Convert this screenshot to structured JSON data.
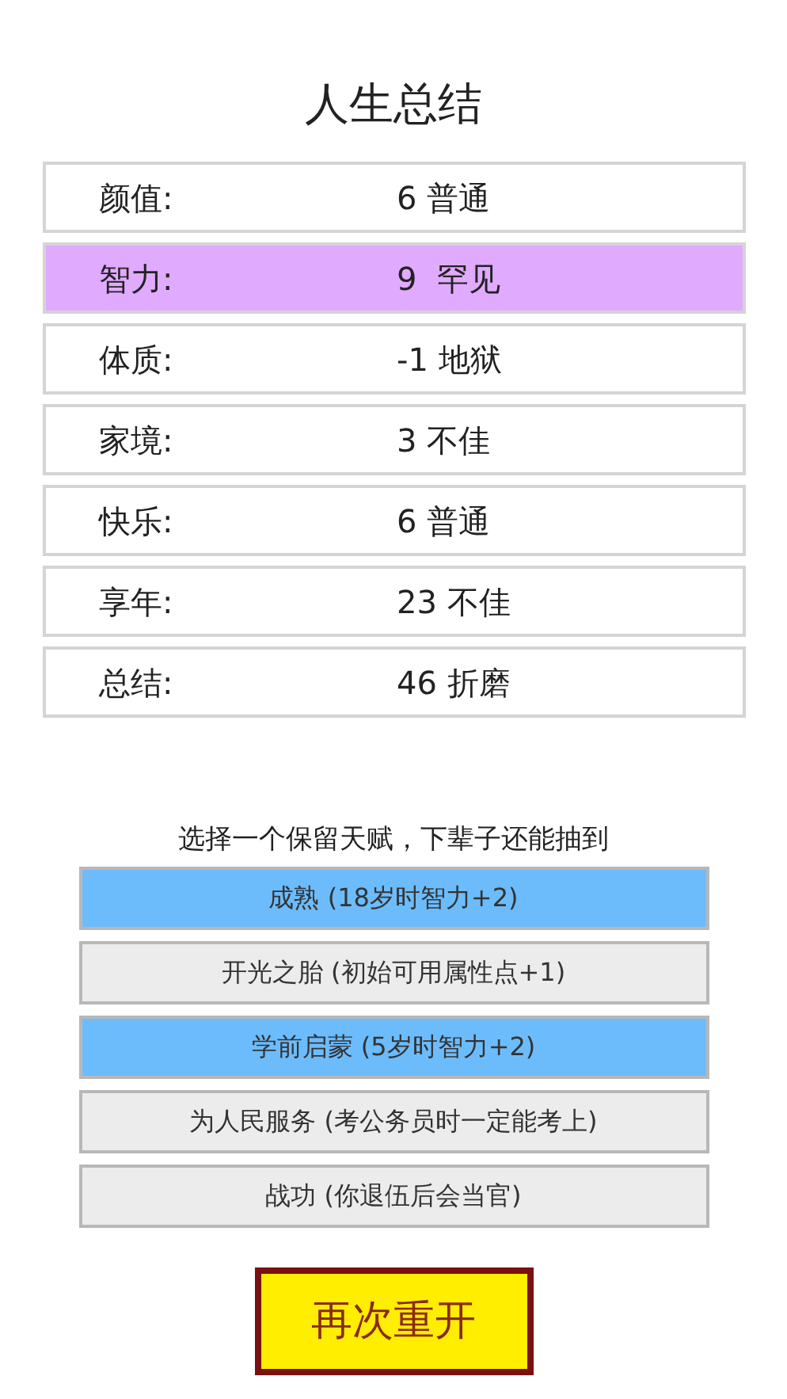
{
  "title": "人生总结",
  "stats": [
    {
      "label": "颜值:",
      "value": "6 普通",
      "color": "#ffffff"
    },
    {
      "label": "智力:",
      "value": "9  罕见",
      "color": "#e0aaff"
    },
    {
      "label": "体质:",
      "value": "-1 地狱",
      "color": "#ffffff"
    },
    {
      "label": "家境:",
      "value": "3 不佳",
      "color": "#ffffff"
    },
    {
      "label": "快乐:",
      "value": "6 普通",
      "color": "#ffffff"
    },
    {
      "label": "享年:",
      "value": "23 不佳",
      "color": "#ffffff"
    },
    {
      "label": "总结:",
      "value": "46 折磨",
      "color": "#ffffff"
    }
  ],
  "prompt": "选择一个保留天赋，下辈子还能抽到",
  "talents": [
    {
      "label": "成熟 (18岁时智力+2)",
      "selected": true
    },
    {
      "label": "开光之胎 (初始可用属性点+1)",
      "selected": false
    },
    {
      "label": "学前启蒙 (5岁时智力+2)",
      "selected": true
    },
    {
      "label": "为人民服务 (考公务员时一定能考上)",
      "selected": false
    },
    {
      "label": "战功 (你退伍后会当官)",
      "selected": false
    }
  ],
  "restart_button": "再次重开"
}
